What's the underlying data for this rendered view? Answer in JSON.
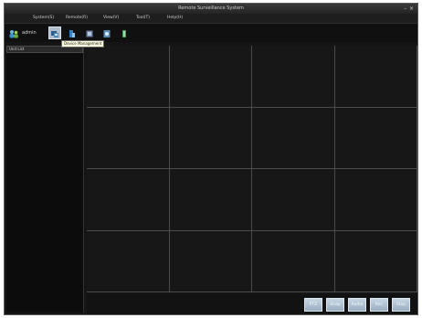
{
  "window": {
    "title": "Remote Surveillance System",
    "minimize_glyph": "–",
    "close_glyph": "×"
  },
  "menu": [
    {
      "label": "System(S)"
    },
    {
      "label": "Remote(R)"
    },
    {
      "label": "View(V)"
    },
    {
      "label": "Tool(T)"
    },
    {
      "label": "Help(H)"
    }
  ],
  "toolbar": {
    "user_label": "admin",
    "buttons": [
      {
        "icon": "device-management-icon",
        "active": true
      },
      {
        "icon": "record-icon",
        "active": false
      },
      {
        "icon": "playback-icon",
        "active": false
      },
      {
        "icon": "config-icon",
        "active": false
      },
      {
        "icon": "log-icon",
        "active": false
      }
    ],
    "tooltip": "Device Management"
  },
  "sidebar": {
    "header": "Unit List"
  },
  "bottom_controls": [
    {
      "label": "PTZ"
    },
    {
      "label": "Snap"
    },
    {
      "label": "Audio"
    },
    {
      "label": "Rec"
    },
    {
      "label": "Stop"
    }
  ],
  "colors": {
    "background": "#151515",
    "button": "#aebccb"
  }
}
